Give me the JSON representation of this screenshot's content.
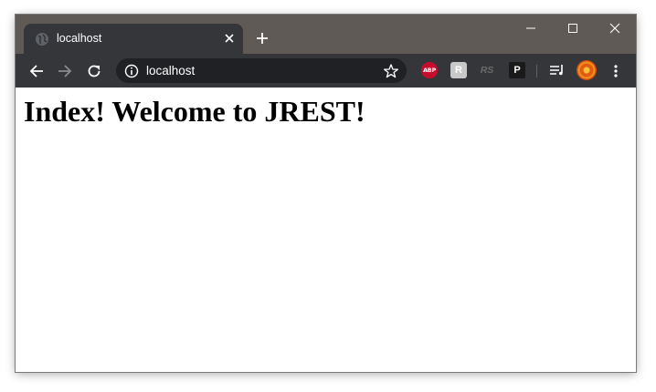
{
  "tab": {
    "title": "localhost"
  },
  "address_bar": {
    "url": "localhost"
  },
  "extensions": {
    "abp_label": "ABP",
    "r_label": "R",
    "rs_label": "RS",
    "p_label": "P"
  },
  "page": {
    "heading": "Index! Welcome to JREST!"
  },
  "colors": {
    "titlebar": "#5f5a55",
    "toolbar": "#35363a",
    "omnibox": "#202124",
    "abp": "#c70d2c"
  }
}
